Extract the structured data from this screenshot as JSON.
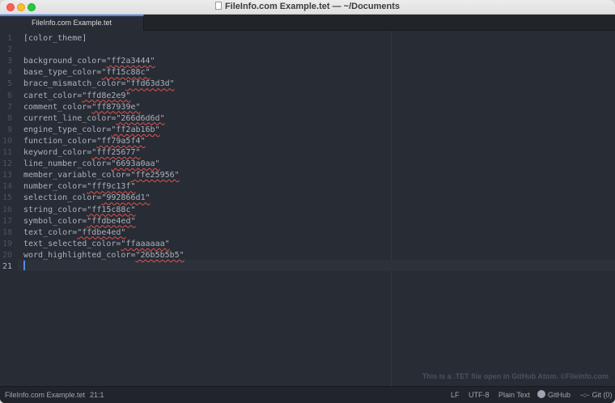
{
  "window": {
    "title": "FileInfo.com Example.tet — ~/Documents"
  },
  "tabs": [
    {
      "label": "FileInfo.com Example.tet"
    }
  ],
  "editor": {
    "lines": [
      {
        "n": "1",
        "key": "[color_theme]",
        "val": ""
      },
      {
        "n": "2",
        "key": "",
        "val": ""
      },
      {
        "n": "3",
        "key": "background_color=",
        "val": "\"ff2a3444\""
      },
      {
        "n": "4",
        "key": "base_type_color=",
        "val": "\"ff15c88c\""
      },
      {
        "n": "5",
        "key": "brace_mismatch_color=",
        "val": "\"ffd63d3d\""
      },
      {
        "n": "6",
        "key": "caret_color=",
        "val": "\"ffd8e2e9\""
      },
      {
        "n": "7",
        "key": "comment_color=",
        "val": "\"ff87939e\""
      },
      {
        "n": "8",
        "key": "current_line_color=",
        "val": "\"266d6d6d\""
      },
      {
        "n": "9",
        "key": "engine_type_color=",
        "val": "\"ff2ab16b\""
      },
      {
        "n": "10",
        "key": "function_color=",
        "val": "\"ff79a5f4\""
      },
      {
        "n": "11",
        "key": "keyword_color=",
        "val": "\"fff25677\""
      },
      {
        "n": "12",
        "key": "line_number_color=",
        "val": "\"6693a0aa\""
      },
      {
        "n": "13",
        "key": "member_variable_color=",
        "val": "\"ffe25956\""
      },
      {
        "n": "14",
        "key": "number_color=",
        "val": "\"fff9c13f\""
      },
      {
        "n": "15",
        "key": "selection_color=",
        "val": "\"992866d1\""
      },
      {
        "n": "16",
        "key": "string_color=",
        "val": "\"ff15c88c\""
      },
      {
        "n": "17",
        "key": "symbol_color=",
        "val": "\"ffdbe4ed\""
      },
      {
        "n": "18",
        "key": "text_color=",
        "val": "\"ffdbe4ed\""
      },
      {
        "n": "19",
        "key": "text_selected_color=",
        "val": "\"ffaaaaaa\""
      },
      {
        "n": "20",
        "key": "word_highlighted_color=",
        "val": "\"26b5b5b5\""
      },
      {
        "n": "21",
        "key": "",
        "val": ""
      }
    ],
    "watermark": "This is a .TET file open in GitHub Atom. ©FileInfo.com"
  },
  "statusbar": {
    "filename": "FileInfo.com Example.tet",
    "cursor_position": "21:1",
    "line_ending": "LF",
    "encoding": "UTF-8",
    "grammar": "Plain Text",
    "github_label": "GitHub",
    "git_label": "Git (0)"
  },
  "colors": {
    "editor_bg": "#282c34",
    "text": "#abb2bf",
    "accent": "#528bff"
  }
}
